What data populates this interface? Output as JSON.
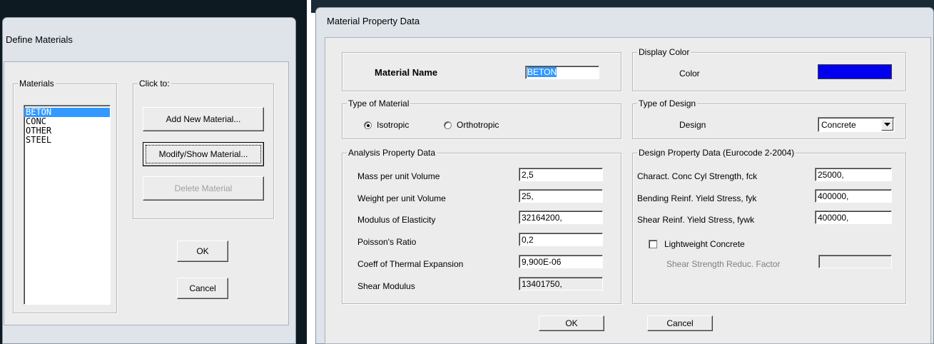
{
  "define_materials": {
    "title": "Define Materials",
    "materials_group": "Materials",
    "click_group": "Click to:",
    "materials": [
      {
        "name": "BETON",
        "selected": true
      },
      {
        "name": "CONC",
        "selected": false
      },
      {
        "name": "OTHER",
        "selected": false
      },
      {
        "name": "STEEL",
        "selected": false
      }
    ],
    "buttons": {
      "add": "Add New Material...",
      "modify": "Modify/Show Material...",
      "delete": "Delete Material",
      "ok": "OK",
      "cancel": "Cancel"
    }
  },
  "material_property": {
    "title": "Material Property Data",
    "material_name_label": "Material Name",
    "material_name_value": "BETON",
    "display_color_group": "Display Color",
    "color_label": "Color",
    "color_value": "#0000ee",
    "type_of_material_group": "Type of Material",
    "isotropic_label": "Isotropic",
    "orthotropic_label": "Orthotropic",
    "type_of_material_selected": "Isotropic",
    "type_of_design_group": "Type of Design",
    "design_label": "Design",
    "design_value": "Concrete",
    "analysis_group": "Analysis Property Data",
    "analysis": [
      {
        "label": "Mass per unit Volume",
        "value": "2,5",
        "readonly": false
      },
      {
        "label": "Weight per unit Volume",
        "value": "25,",
        "readonly": false
      },
      {
        "label": "Modulus of Elasticity",
        "value": "32164200,",
        "readonly": false
      },
      {
        "label": "Poisson's Ratio",
        "value": "0,2",
        "readonly": false
      },
      {
        "label": "Coeff of Thermal Expansion",
        "value": "9,900E-06",
        "readonly": false
      },
      {
        "label": "Shear Modulus",
        "value": "13401750,",
        "readonly": true
      }
    ],
    "design_group": "Design Property Data (Eurocode 2-2004)",
    "design_props": [
      {
        "label": "Charact. Conc Cyl Strength, fck",
        "value": "25000,"
      },
      {
        "label": "Bending Reinf. Yield Stress, fyk",
        "value": "400000,"
      },
      {
        "label": "Shear Reinf. Yield Stress, fywk",
        "value": "400000,"
      }
    ],
    "lightweight_label": "Lightweight Concrete",
    "lightweight_checked": false,
    "shear_reduc_label": "Shear Strength Reduc. Factor",
    "shear_reduc_value": "",
    "ok": "OK",
    "cancel": "Cancel"
  }
}
